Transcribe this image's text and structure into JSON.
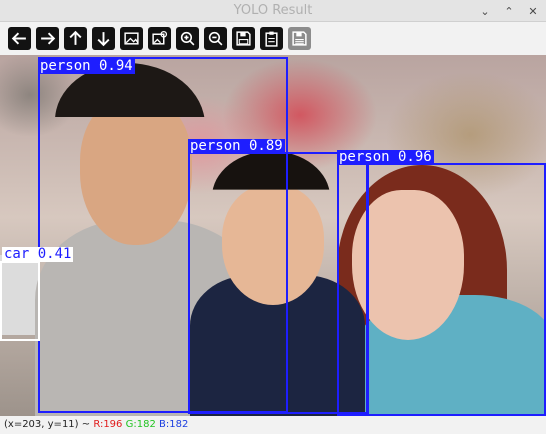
{
  "window": {
    "title": "YOLO Result",
    "buttons": [
      {
        "name": "minimize",
        "glyph": "⌄"
      },
      {
        "name": "maximize",
        "glyph": "⌃"
      },
      {
        "name": "close",
        "glyph": "✕"
      }
    ]
  },
  "toolbar": {
    "tools": [
      {
        "icon": "arrow-left-icon",
        "enabled": true
      },
      {
        "icon": "arrow-right-icon",
        "enabled": true
      },
      {
        "icon": "arrow-up-icon",
        "enabled": true
      },
      {
        "icon": "arrow-down-icon",
        "enabled": true
      },
      {
        "icon": "image-icon",
        "enabled": true
      },
      {
        "icon": "image-settings-icon",
        "enabled": true
      },
      {
        "icon": "zoom-in-icon",
        "enabled": true
      },
      {
        "icon": "zoom-out-icon",
        "enabled": true
      },
      {
        "icon": "save-icon",
        "enabled": true
      },
      {
        "icon": "clipboard-icon",
        "enabled": true
      },
      {
        "icon": "save-disabled-icon",
        "enabled": false
      }
    ]
  },
  "detections": [
    {
      "label": "person 0.94",
      "class": "person",
      "confidence": 0.94
    },
    {
      "label": "person 0.89",
      "class": "person",
      "confidence": 0.89
    },
    {
      "label": "person 0.96",
      "class": "person",
      "confidence": 0.96
    },
    {
      "label": "car 0.41",
      "class": "car",
      "confidence": 0.41
    }
  ],
  "status": {
    "coords": "(x=203, y=11) ~",
    "r": "R:196",
    "g": "G:182",
    "b": "B:182"
  },
  "colors": {
    "box": "#1e1eff",
    "status_r": "#e01b1b",
    "status_g": "#23c423",
    "status_b": "#1b3ee0"
  }
}
